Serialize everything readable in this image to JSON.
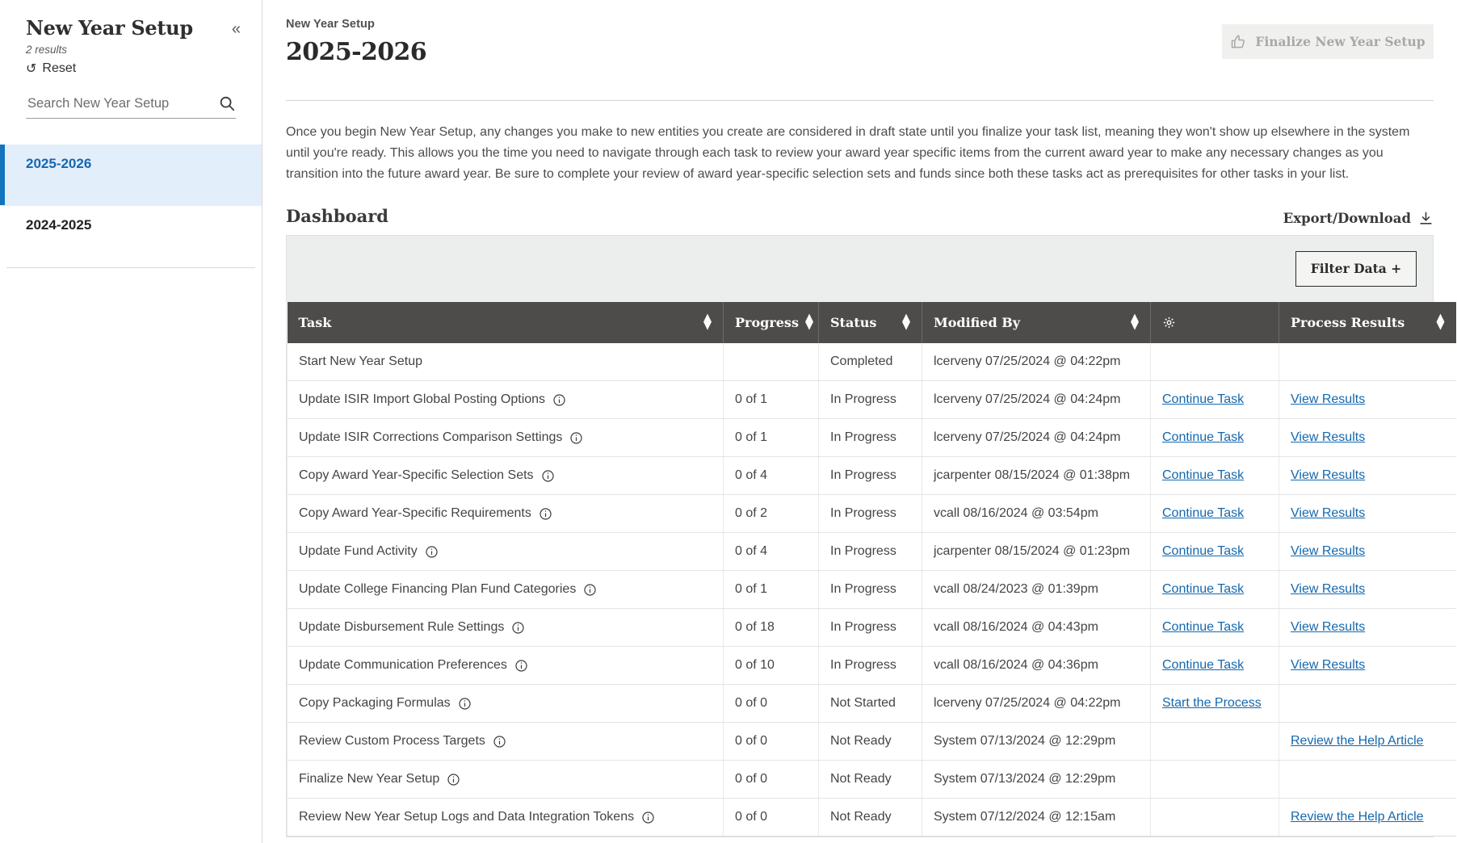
{
  "sidebar": {
    "title": "New Year Setup",
    "results_label": "2 results",
    "reset_label": "Reset",
    "collapse_icon": "chevron-double-left-icon",
    "search": {
      "placeholder": "Search New Year Setup",
      "value": "",
      "icon": "search-icon"
    },
    "items": [
      {
        "label": "2025-2026",
        "selected": true
      },
      {
        "label": "2024-2025",
        "selected": false
      }
    ]
  },
  "header": {
    "breadcrumb": "New Year Setup",
    "title": "2025-2026",
    "finalize_button": {
      "label": "Finalize New Year Setup",
      "icon": "thumbs-up-icon",
      "disabled": true
    }
  },
  "intro": {
    "text": "Once you begin New Year Setup, any changes you make to new entities you create are considered in draft state until you finalize your task list, meaning they won't show up elsewhere in the system until you're ready. This allows you the time you need to navigate through each task to review your award year specific items from the current award year to make any necessary changes as you transition into the future award year. Be sure to complete your review of award year-specific selection sets and funds since both these tasks act as prerequisites for other tasks in your list."
  },
  "dashboard": {
    "title": "Dashboard",
    "export_label": "Export/Download",
    "export_icon": "download-icon",
    "filter_label": "Filter Data +",
    "columns": [
      {
        "label": "Task",
        "sortable": true
      },
      {
        "label": "Progress",
        "sortable": true
      },
      {
        "label": "Status",
        "sortable": true
      },
      {
        "label": "Modified By",
        "sortable": true
      },
      {
        "label": "",
        "icon": "gear-icon",
        "sortable": false
      },
      {
        "label": "Process Results",
        "sortable": true
      }
    ],
    "rows": [
      {
        "task": "Start New Year Setup",
        "has_info": false,
        "progress": "",
        "status": "Completed",
        "modified_by": "lcerveny 07/25/2024 @ 04:22pm",
        "action": "",
        "results": ""
      },
      {
        "task": "Update ISIR Import Global Posting Options",
        "has_info": true,
        "progress": "0 of 1",
        "status": "In Progress",
        "modified_by": "lcerveny 07/25/2024 @ 04:24pm",
        "action": "Continue Task",
        "results": "View Results"
      },
      {
        "task": "Update ISIR Corrections Comparison Settings",
        "has_info": true,
        "progress": "0 of 1",
        "status": "In Progress",
        "modified_by": "lcerveny 07/25/2024 @ 04:24pm",
        "action": "Continue Task",
        "results": "View Results"
      },
      {
        "task": "Copy Award Year-Specific Selection Sets",
        "has_info": true,
        "progress": "0 of 4",
        "status": "In Progress",
        "modified_by": "jcarpenter 08/15/2024 @ 01:38pm",
        "action": "Continue Task",
        "results": "View Results"
      },
      {
        "task": "Copy Award Year-Specific Requirements",
        "has_info": true,
        "progress": "0 of 2",
        "status": "In Progress",
        "modified_by": "vcall 08/16/2024 @ 03:54pm",
        "action": "Continue Task",
        "results": "View Results"
      },
      {
        "task": "Update Fund Activity",
        "has_info": true,
        "progress": "0 of 4",
        "status": "In Progress",
        "modified_by": "jcarpenter 08/15/2024 @ 01:23pm",
        "action": "Continue Task",
        "results": "View Results"
      },
      {
        "task": "Update College Financing Plan Fund Categories",
        "has_info": true,
        "progress": "0 of 1",
        "status": "In Progress",
        "modified_by": "vcall 08/24/2023 @ 01:39pm",
        "action": "Continue Task",
        "results": "View Results"
      },
      {
        "task": "Update Disbursement Rule Settings",
        "has_info": true,
        "progress": "0 of 18",
        "status": "In Progress",
        "modified_by": "vcall 08/16/2024 @ 04:43pm",
        "action": "Continue Task",
        "results": "View Results"
      },
      {
        "task": "Update Communication Preferences",
        "has_info": true,
        "progress": "0 of 10",
        "status": "In Progress",
        "modified_by": "vcall 08/16/2024 @ 04:36pm",
        "action": "Continue Task",
        "results": "View Results"
      },
      {
        "task": "Copy Packaging Formulas",
        "has_info": true,
        "progress": "0 of 0",
        "status": "Not Started",
        "modified_by": "lcerveny 07/25/2024 @ 04:22pm",
        "action": "Start the Process",
        "results": ""
      },
      {
        "task": "Review Custom Process Targets",
        "has_info": true,
        "progress": "0 of 0",
        "status": "Not Ready",
        "modified_by": "System 07/13/2024 @ 12:29pm",
        "action": "",
        "results": "Review the Help Article"
      },
      {
        "task": "Finalize New Year Setup",
        "has_info": true,
        "progress": "0 of 0",
        "status": "Not Ready",
        "modified_by": "System 07/13/2024 @ 12:29pm",
        "action": "",
        "results": ""
      },
      {
        "task": "Review New Year Setup Logs and Data Integration Tokens",
        "has_info": true,
        "progress": "0 of 0",
        "status": "Not Ready",
        "modified_by": "System 07/12/2024 @ 12:15am",
        "action": "",
        "results": "Review the Help Article"
      }
    ]
  },
  "colors": {
    "accent_blue": "#1274bc",
    "link_blue": "#1468ae",
    "selected_row_bg": "#e3eefb",
    "table_header_bg": "#4e4c4a",
    "panel_bg": "#eceded",
    "disabled_btn_bg": "#f0f0ee"
  }
}
